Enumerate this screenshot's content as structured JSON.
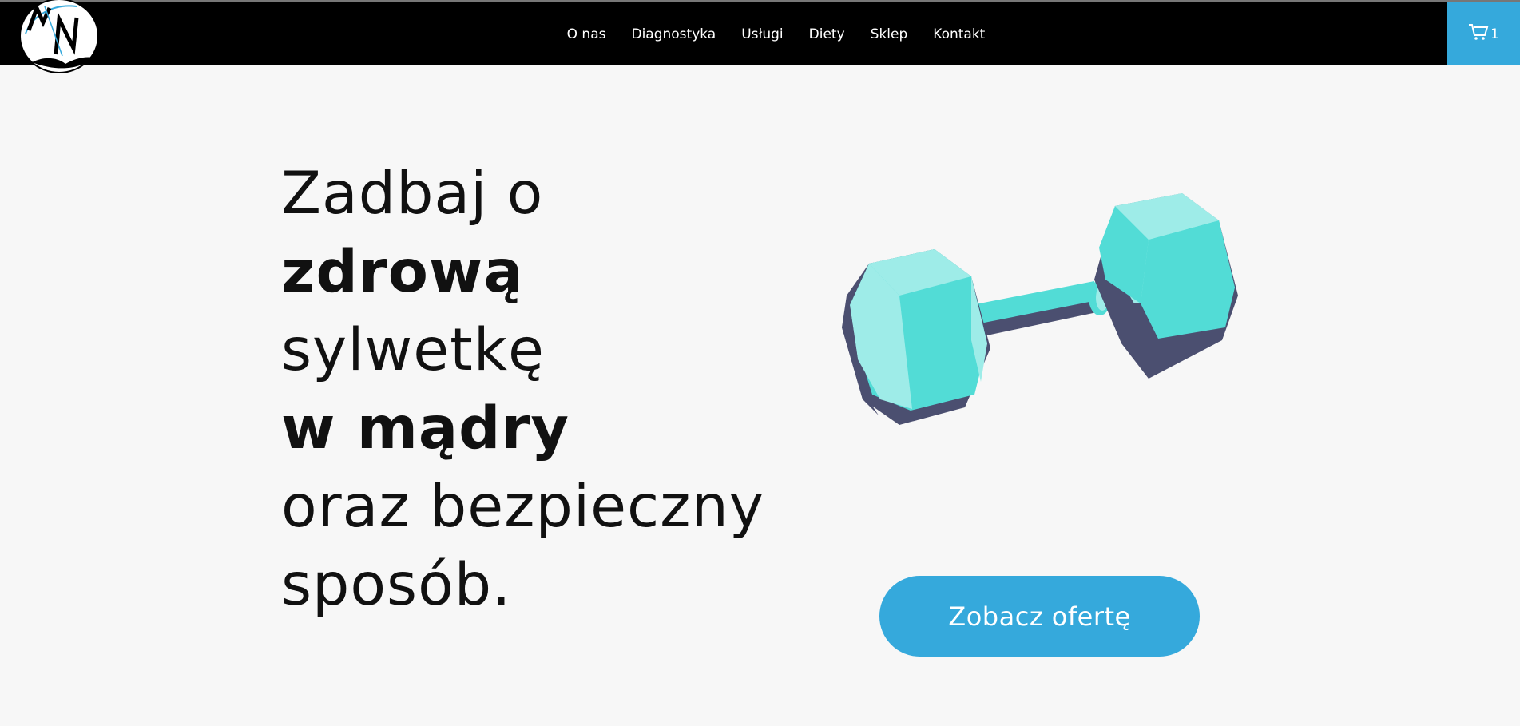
{
  "header": {
    "logo_text": "MN",
    "nav": [
      {
        "label": "O nas"
      },
      {
        "label": "Diagnostyka"
      },
      {
        "label": "Usługi"
      },
      {
        "label": "Diety"
      },
      {
        "label": "Sklep"
      },
      {
        "label": "Kontakt"
      }
    ],
    "cart_count": "1"
  },
  "hero": {
    "lines": [
      {
        "text": "Zadbaj o",
        "weight": "light"
      },
      {
        "text": "zdrową",
        "weight": "bold"
      },
      {
        "text": "sylwetkę",
        "weight": "light"
      },
      {
        "text": "w mądry",
        "weight": "bold"
      },
      {
        "text": "oraz bezpieczny",
        "weight": "light"
      },
      {
        "text": "sposób.",
        "weight": "light"
      }
    ],
    "cta_label": "Zobacz ofertę"
  },
  "colors": {
    "accent": "#35a9dc",
    "header_bg": "#000000",
    "page_bg": "#f7f7f7",
    "dumbbell_light": "#9eece8",
    "dumbbell_mid": "#52dcd6",
    "dumbbell_dark": "#4b4f70"
  }
}
